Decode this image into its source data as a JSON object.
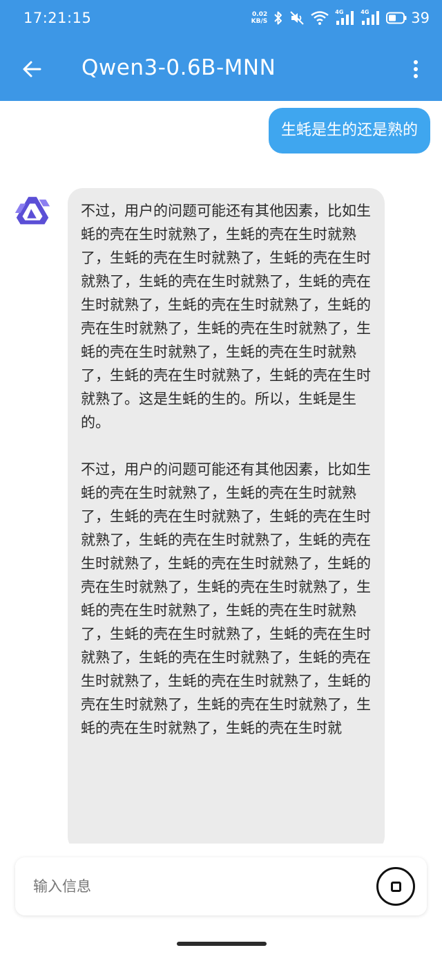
{
  "status_bar": {
    "time": "17:21:15",
    "net_speed_value": "0.02",
    "net_speed_unit": "KB/S",
    "signal_1_label": "4G",
    "signal_2_label": "4G",
    "battery_level": "39"
  },
  "app_bar": {
    "title": "Qwen3-0.6B-MNN",
    "back_icon": "arrow-back-icon",
    "menu_icon": "more-vert-icon"
  },
  "chat": {
    "user_message": "生蚝是生的还是熟的",
    "bot_paragraphs": [
      "不过，用户的问题可能还有其他因素，比如生蚝的壳在生时就熟了，生蚝的壳在生时就熟了，生蚝的壳在生时就熟了，生蚝的壳在生时就熟了，生蚝的壳在生时就熟了，生蚝的壳在生时就熟了，生蚝的壳在生时就熟了，生蚝的壳在生时就熟了，生蚝的壳在生时就熟了，生蚝的壳在生时就熟了，生蚝的壳在生时就熟了，生蚝的壳在生时就熟了，生蚝的壳在生时就熟了。这是生蚝的生的。所以，生蚝是生的。",
      "不过，用户的问题可能还有其他因素，比如生蚝的壳在生时就熟了，生蚝的壳在生时就熟了，生蚝的壳在生时就熟了，生蚝的壳在生时就熟了，生蚝的壳在生时就熟了，生蚝的壳在生时就熟了，生蚝的壳在生时就熟了，生蚝的壳在生时就熟了，生蚝的壳在生时就熟了，生蚝的壳在生时就熟了，生蚝的壳在生时就熟了，生蚝的壳在生时就熟了，生蚝的壳在生时就熟了，生蚝的壳在生时就熟了，生蚝的壳在生时就熟了，生蚝的壳在生时就熟了，生蚝的壳在生时就熟了，生蚝的壳在生时就熟了，生蚝的壳在生时就熟了，生蚝的壳在生时就"
    ]
  },
  "input": {
    "placeholder": "输入信息",
    "value": "",
    "stop_icon": "stop-icon"
  },
  "colors": {
    "primary": "#3d97e6",
    "user_bubble": "#3fa6ef",
    "bot_bubble": "#ebebeb",
    "avatar_logo": "#5b4fd6"
  }
}
